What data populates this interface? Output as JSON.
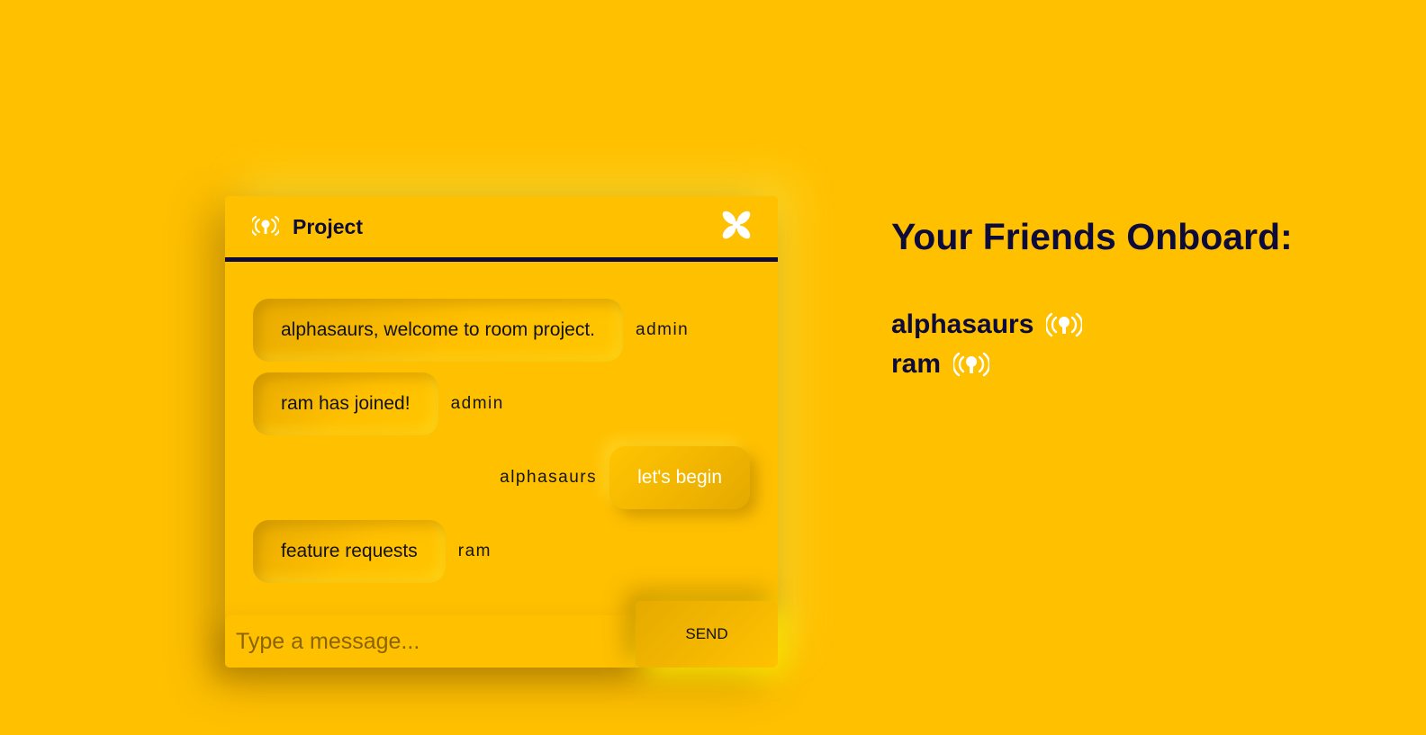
{
  "chat": {
    "room_title": "Project",
    "header_icon": "live-broadcast-icon",
    "close_icon": "close-x-icon",
    "messages": [
      {
        "text": "alphasaurs, welcome to room project.",
        "sender": "admin",
        "side": "received"
      },
      {
        "text": "ram has joined!",
        "sender": "admin",
        "side": "received"
      },
      {
        "text": "let's begin",
        "sender": "alphasaurs",
        "side": "sent"
      },
      {
        "text": "feature requests",
        "sender": "ram",
        "side": "received"
      }
    ],
    "input": {
      "placeholder": "Type a message...",
      "value": ""
    },
    "send_label": "SEND"
  },
  "friends": {
    "title": "Your Friends Onboard:",
    "online_icon": "live-broadcast-icon",
    "list": [
      {
        "name": "alphasaurs"
      },
      {
        "name": "ram"
      }
    ]
  },
  "colors": {
    "background": "#ffc000",
    "text_dark": "#0d0b3a",
    "icon_white": "#ffffff"
  }
}
